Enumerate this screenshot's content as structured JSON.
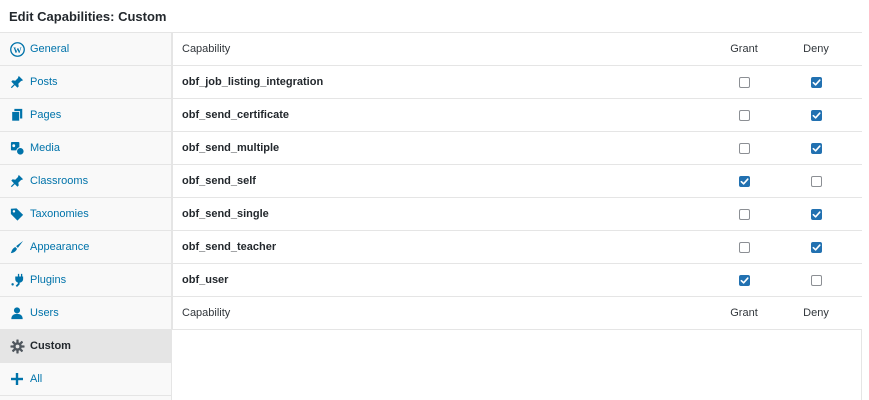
{
  "title": "Edit Capabilities: Custom",
  "sidebar": {
    "items": [
      {
        "label": "General",
        "icon": "wordpress-icon"
      },
      {
        "label": "Posts",
        "icon": "pin-icon"
      },
      {
        "label": "Pages",
        "icon": "pages-icon"
      },
      {
        "label": "Media",
        "icon": "media-icon"
      },
      {
        "label": "Classrooms",
        "icon": "pin-icon"
      },
      {
        "label": "Taxonomies",
        "icon": "tag-icon"
      },
      {
        "label": "Appearance",
        "icon": "brush-icon"
      },
      {
        "label": "Plugins",
        "icon": "plug-icon"
      },
      {
        "label": "Users",
        "icon": "user-icon"
      },
      {
        "label": "Custom",
        "icon": "gear-icon",
        "active": true
      },
      {
        "label": "All",
        "icon": "plus-icon"
      }
    ]
  },
  "table": {
    "header": {
      "capability": "Capability",
      "grant": "Grant",
      "deny": "Deny"
    },
    "footer": {
      "capability": "Capability",
      "grant": "Grant",
      "deny": "Deny"
    },
    "rows": [
      {
        "name": "obf_job_listing_integration",
        "grant": false,
        "deny": true
      },
      {
        "name": "obf_send_certificate",
        "grant": false,
        "deny": true
      },
      {
        "name": "obf_send_multiple",
        "grant": false,
        "deny": true
      },
      {
        "name": "obf_send_self",
        "grant": true,
        "deny": false
      },
      {
        "name": "obf_send_single",
        "grant": false,
        "deny": true
      },
      {
        "name": "obf_send_teacher",
        "grant": false,
        "deny": true
      },
      {
        "name": "obf_user",
        "grant": true,
        "deny": false
      }
    ]
  },
  "colors": {
    "link": "#0073aa",
    "accent": "#2271b1",
    "border": "#e5e5e5",
    "sidebar_bg": "#f9f9f9",
    "active_bg": "#e5e5e5"
  }
}
